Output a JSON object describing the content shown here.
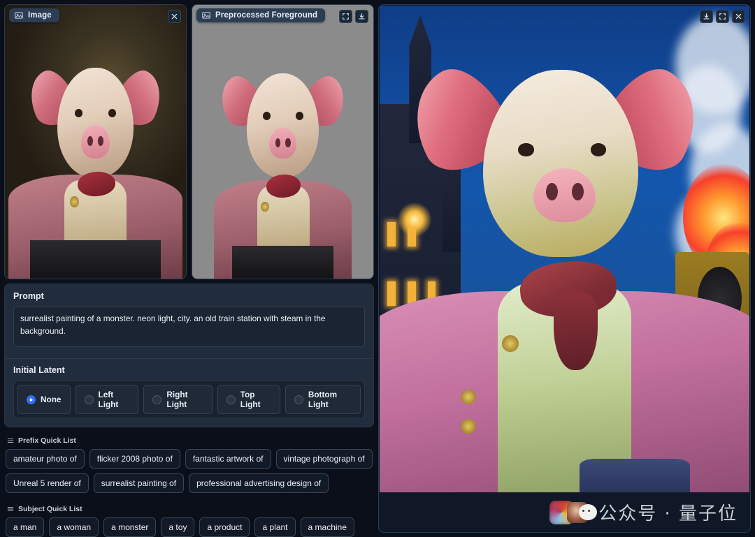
{
  "panels": {
    "input_image": {
      "title": "Image",
      "icon": "image-icon",
      "tools": [
        {
          "name": "close-icon",
          "label": "×"
        }
      ]
    },
    "preprocessed": {
      "title": "Preprocessed Foreground",
      "icon": "image-icon",
      "tools": [
        {
          "name": "fullscreen-icon",
          "label": "fullscreen"
        },
        {
          "name": "download-icon",
          "label": "download"
        }
      ]
    },
    "result": {
      "tools": [
        {
          "name": "download-icon",
          "label": "download"
        },
        {
          "name": "fullscreen-icon",
          "label": "fullscreen"
        },
        {
          "name": "close-icon",
          "label": "close"
        }
      ],
      "watermark": "公众号 · 量子位"
    }
  },
  "form": {
    "prompt_label": "Prompt",
    "prompt_value": "surrealist painting of a monster. neon light, city. an old train station with steam in the background.",
    "prompt_placeholder": "",
    "initial_latent_label": "Initial Latent",
    "initial_latent_options": [
      {
        "label": "None",
        "selected": true
      },
      {
        "label": "Left Light",
        "selected": false
      },
      {
        "label": "Right Light",
        "selected": false
      },
      {
        "label": "Top Light",
        "selected": false
      },
      {
        "label": "Bottom Light",
        "selected": false
      }
    ]
  },
  "prefix_quick_list": {
    "title": "Prefix Quick List",
    "icon": "list-icon",
    "items": [
      "amateur photo of",
      "flicker 2008 photo of",
      "fantastic artwork of",
      "vintage photograph of",
      "Unreal 5 render of",
      "surrealist painting of",
      "professional advertising design of"
    ]
  },
  "subject_quick_list": {
    "title": "Subject Quick List",
    "icon": "list-icon",
    "items": [
      "a man",
      "a woman",
      "a monster",
      "a toy",
      "a product",
      "a plant",
      "a machine"
    ]
  },
  "colors": {
    "page_bg": "#0b0f19",
    "panel_bg": "#212c3c",
    "panel_header": "#2c3e55",
    "accent": "#2f6df5",
    "text": "#e8eef6"
  }
}
